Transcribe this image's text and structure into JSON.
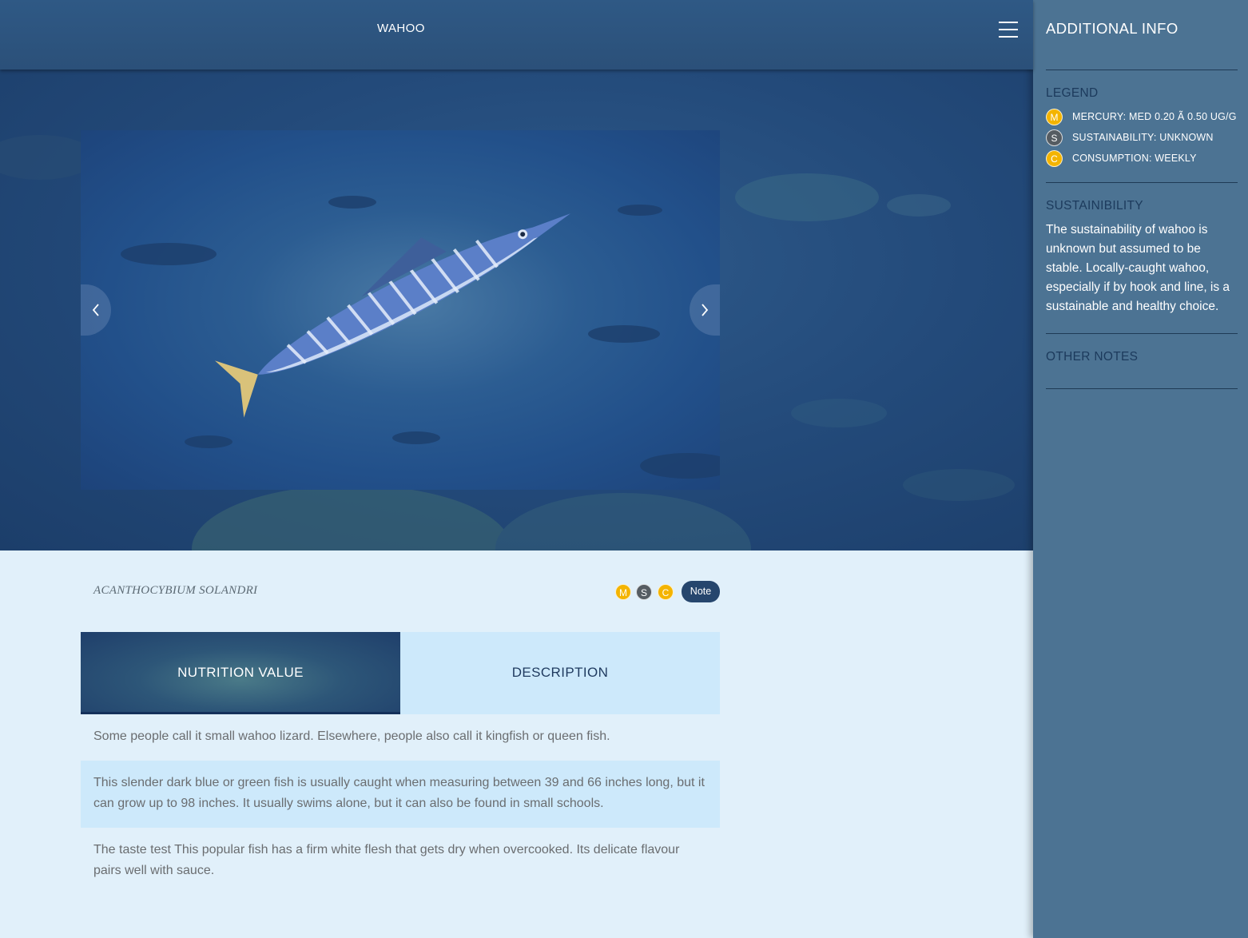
{
  "header": {
    "title": "WAHOO"
  },
  "fish": {
    "scientific_name": "ACANTHOCYBIUM SOLANDRI"
  },
  "badges": {
    "mercury": "M",
    "sustainability": "S",
    "consumption": "C"
  },
  "note_button": "Note",
  "tabs": [
    {
      "label": "NUTRITION VALUE",
      "active": true
    },
    {
      "label": "DESCRIPTION",
      "active": false
    }
  ],
  "paragraphs": [
    "Some people call it small wahoo lizard. Elsewhere, people also call it kingfish or queen fish.",
    "This slender dark blue or green fish is usually caught when measuring between 39 and 66 inches long, but it can grow up to 98 inches. It usually swims alone, but it can also be found in small schools.",
    "The taste test This popular fish has a firm white flesh that gets dry when overcooked. Its delicate flavour pairs well with sauce."
  ],
  "sidebar": {
    "title": "ADDITIONAL INFO",
    "legend_heading": "LEGEND",
    "legend": [
      {
        "badge": "M",
        "label": "MERCURY: MED 0.20 Ã 0.50 UG/G",
        "color": "#f4b400"
      },
      {
        "badge": "S",
        "label": "SUSTAINABILITY: UNKNOWN",
        "color": "#555c62"
      },
      {
        "badge": "C",
        "label": "CONSUMPTION: WEEKLY",
        "color": "#f4b400"
      }
    ],
    "sustainability_heading": "SUSTAINIBILITY",
    "sustainability_text": "The sustainability of wahoo is unknown but assumed to be stable. Locally-caught wahoo, especially if by hook and line, is a sustainable and healthy choice.",
    "other_notes_heading": "OTHER NOTES"
  },
  "colors": {
    "header": "#2f5985",
    "sidebar": "#4c7393",
    "badge_yellow": "#f4b400",
    "badge_gray": "#555c62",
    "tab_light": "#cde9fb"
  },
  "icons": [
    "hamburger-menu-icon",
    "chevron-left-icon",
    "chevron-right-icon"
  ]
}
